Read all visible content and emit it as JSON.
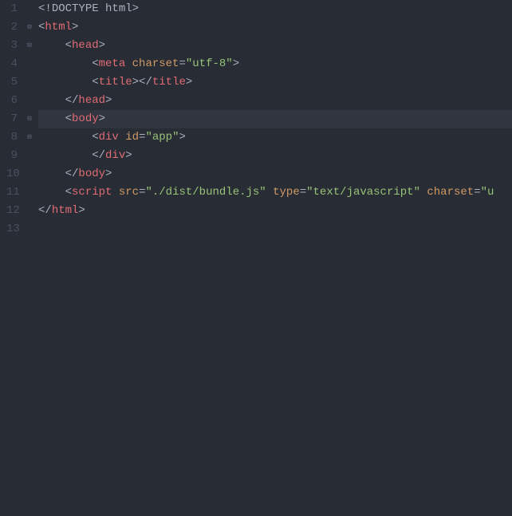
{
  "lineNumbers": [
    "1",
    "2",
    "3",
    "4",
    "5",
    "6",
    "7",
    "8",
    "9",
    "10",
    "11",
    "12",
    "13"
  ],
  "foldMarkers": {
    "2": true,
    "3": true,
    "7": true,
    "8": true
  },
  "highlightedLine": 7,
  "code": {
    "line1": {
      "bracket_open": "<!",
      "doctype_kw": "DOCTYPE",
      "space": " ",
      "doctype_val": "html",
      "bracket_close": ">"
    },
    "line2": {
      "bracket_open": "<",
      "tag": "html",
      "bracket_close": ">"
    },
    "line3": {
      "indent": "    ",
      "bracket_open": "<",
      "tag": "head",
      "bracket_close": ">"
    },
    "line4": {
      "indent": "        ",
      "bracket_open": "<",
      "tag": "meta",
      "space": " ",
      "attr": "charset",
      "eq": "=",
      "quote1": "\"",
      "val": "utf-8",
      "quote2": "\"",
      "bracket_close": ">"
    },
    "line5": {
      "indent": "        ",
      "bracket_open": "<",
      "tag": "title",
      "bracket_close": ">",
      "bracket_open2": "</",
      "tag2": "title",
      "bracket_close2": ">"
    },
    "line6": {
      "indent": "    ",
      "bracket_open": "</",
      "tag": "head",
      "bracket_close": ">"
    },
    "line7": {
      "indent": "    ",
      "bracket_open": "<",
      "tag": "body",
      "bracket_close": ">"
    },
    "line8": {
      "indent": "        ",
      "bracket_open": "<",
      "tag": "div",
      "space": " ",
      "attr": "id",
      "eq": "=",
      "quote1": "\"",
      "val": "app",
      "quote2": "\"",
      "bracket_close": ">"
    },
    "line9": {
      "indent": "        ",
      "bracket_open": "</",
      "tag": "div",
      "bracket_close": ">"
    },
    "line10": {
      "indent": "    ",
      "bracket_open": "</",
      "tag": "body",
      "bracket_close": ">"
    },
    "line11": {
      "indent": "    ",
      "bracket_open": "<",
      "tag": "script",
      "s1": " ",
      "attr1": "src",
      "eq1": "=",
      "q1a": "\"",
      "val1": "./dist/bundle.js",
      "q1b": "\"",
      "s2": " ",
      "attr2": "type",
      "eq2": "=",
      "q2a": "\"",
      "val2": "text/javascript",
      "q2b": "\"",
      "s3": " ",
      "attr3": "charset",
      "eq3": "=",
      "q3a": "\"",
      "val3_partial": "u"
    },
    "line12": {
      "bracket_open": "</",
      "tag": "html",
      "bracket_close": ">"
    }
  }
}
